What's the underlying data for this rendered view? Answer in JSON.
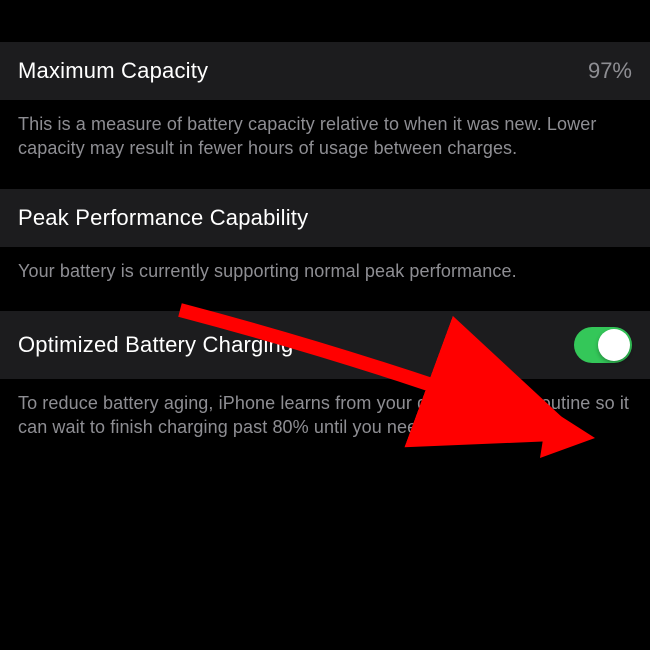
{
  "sections": [
    {
      "title": "Maximum Capacity",
      "value": "97%",
      "description": "This is a measure of battery capacity relative to when it was new. Lower capacity may result in fewer hours of usage between charges."
    },
    {
      "title": "Peak Performance Capability",
      "description": "Your battery is currently supporting normal peak performance."
    },
    {
      "title": "Optimized Battery Charging",
      "toggle": true,
      "description": "To reduce battery aging, iPhone learns from your daily charging routine so it can wait to finish charging past 80% until you need to use it."
    }
  ]
}
